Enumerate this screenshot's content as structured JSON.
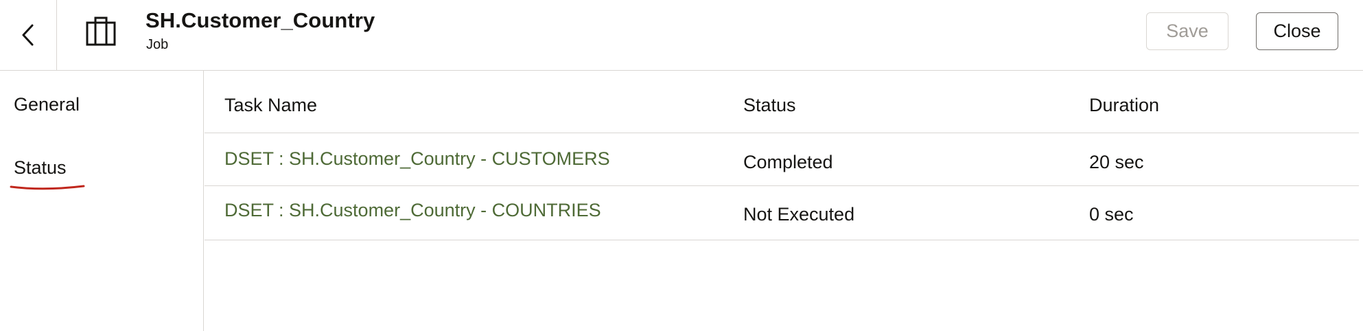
{
  "header": {
    "title": "SH.Customer_Country",
    "subtitle": "Job",
    "save_label": "Save",
    "close_label": "Close",
    "back_icon": "chevron-left-icon",
    "type_icon": "briefcase-icon"
  },
  "sidebar": {
    "items": [
      {
        "label": "General",
        "selected": false
      },
      {
        "label": "Status",
        "selected": true
      }
    ],
    "underline_color": "#c0271c"
  },
  "table": {
    "columns": [
      "Task Name",
      "Status",
      "Duration"
    ],
    "rows": [
      {
        "task": "DSET : SH.Customer_Country - CUSTOMERS",
        "status": "Completed",
        "duration": "20 sec"
      },
      {
        "task": "DSET : SH.Customer_Country - COUNTRIES",
        "status": "Not Executed",
        "duration": "0 sec"
      }
    ]
  },
  "colors": {
    "link": "#4e6a36",
    "border": "#d9d6d2",
    "disabled_text": "#a09c97"
  }
}
